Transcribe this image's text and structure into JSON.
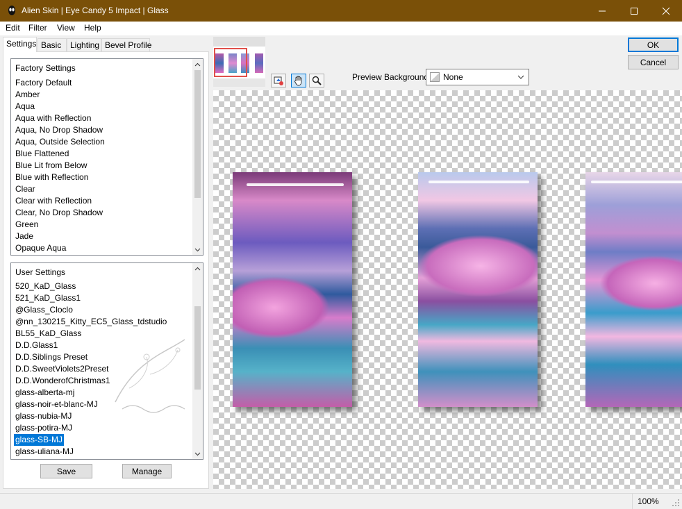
{
  "window": {
    "title": "Alien Skin | Eye Candy 5 Impact | Glass",
    "colors": {
      "titlebar": "#7a5008",
      "selection": "#0078d7"
    }
  },
  "menu": [
    "Edit",
    "Filter",
    "View",
    "Help"
  ],
  "tabs": [
    "Settings",
    "Basic",
    "Lighting",
    "Bevel Profile"
  ],
  "factory_settings": {
    "header": "Factory Settings",
    "items": [
      "Factory Default",
      "Amber",
      "Aqua",
      "Aqua with Reflection",
      "Aqua, No Drop Shadow",
      "Aqua, Outside Selection",
      "Blue Flattened",
      "Blue Lit from Below",
      "Blue with Reflection",
      "Clear",
      "Clear with Reflection",
      "Clear, No Drop Shadow",
      "Green",
      "Jade",
      "Opaque Aqua"
    ]
  },
  "user_settings": {
    "header": "User Settings",
    "items": [
      "520_KaD_Glass",
      "521_KaD_Glass1",
      "@Glass_Cloclo",
      "@nn_130215_Kitty_EC5_Glass_tdstudio",
      "BL55_KaD_Glass",
      "D.D.Glass1",
      "D.D.Siblings Preset",
      "D.D.SweetViolets2Preset",
      "D.D.WonderofChristmas1",
      "glass-alberta-mj",
      "glass-noir-et-blanc-MJ",
      "glass-nubia-MJ",
      "glass-potira-MJ",
      "glass-SB-MJ",
      "glass-uliana-MJ"
    ],
    "selected": "glass-SB-MJ"
  },
  "buttons": {
    "save": "Save",
    "manage": "Manage",
    "ok": "OK",
    "cancel": "Cancel"
  },
  "preview": {
    "background_label": "Preview Background:",
    "background_value": "None",
    "tools": [
      "auto-preview-icon",
      "hand-pan-icon",
      "zoom-icon"
    ]
  },
  "status": {
    "zoom": "100%"
  }
}
